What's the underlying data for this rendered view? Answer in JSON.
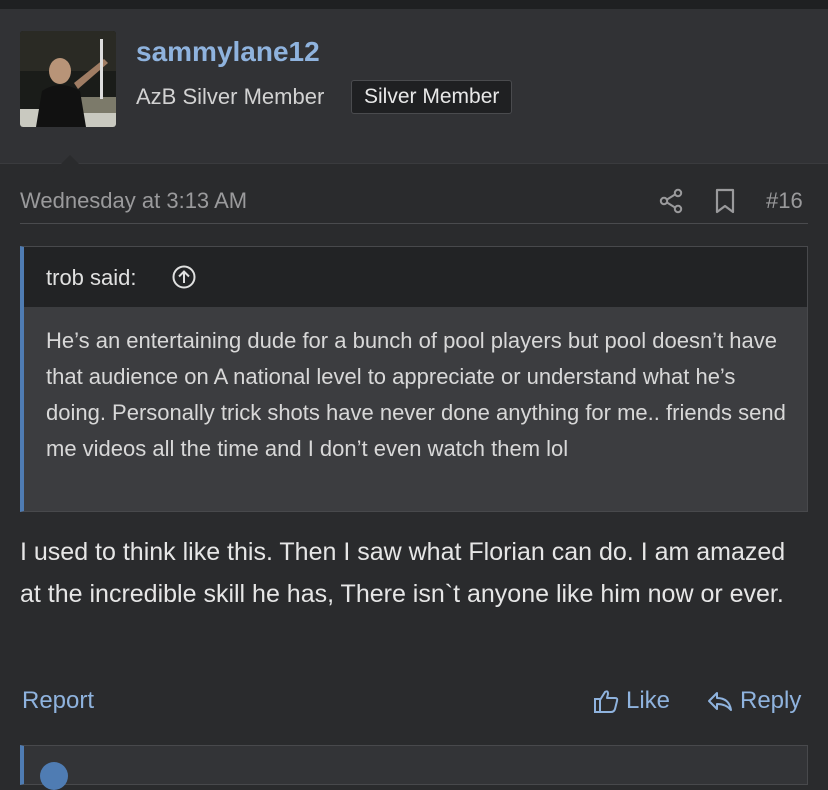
{
  "author": {
    "username": "sammylane12",
    "title": "AzB Silver Member",
    "badge": "Silver Member"
  },
  "post": {
    "date": "Wednesday at 3:13 AM",
    "number": "#16",
    "body": "I used to think like this. Then I saw what Florian can do. I am amazed at the incredible skill he has, There isn`t anyone like him now or ever."
  },
  "quote": {
    "author": "trob said:",
    "text": "He’s an entertaining dude for a bunch of pool players but pool doesn’t have that audience on A national level to appreciate or understand what he’s doing. Personally trick shots have never done anything for me.. friends send me videos all the time and I don’t even watch them lol"
  },
  "actions": {
    "report": "Report",
    "like": "Like",
    "reply": "Reply"
  },
  "icons": {
    "share": "share-icon",
    "bookmark": "bookmark-icon",
    "quote_jump": "arrow-up-circle-icon",
    "like": "thumbs-up-icon",
    "reply": "reply-arrow-icon"
  },
  "colors": {
    "link": "#8fb3de",
    "quote_bar": "#4f7cb3",
    "background": "#2a2b2d"
  }
}
